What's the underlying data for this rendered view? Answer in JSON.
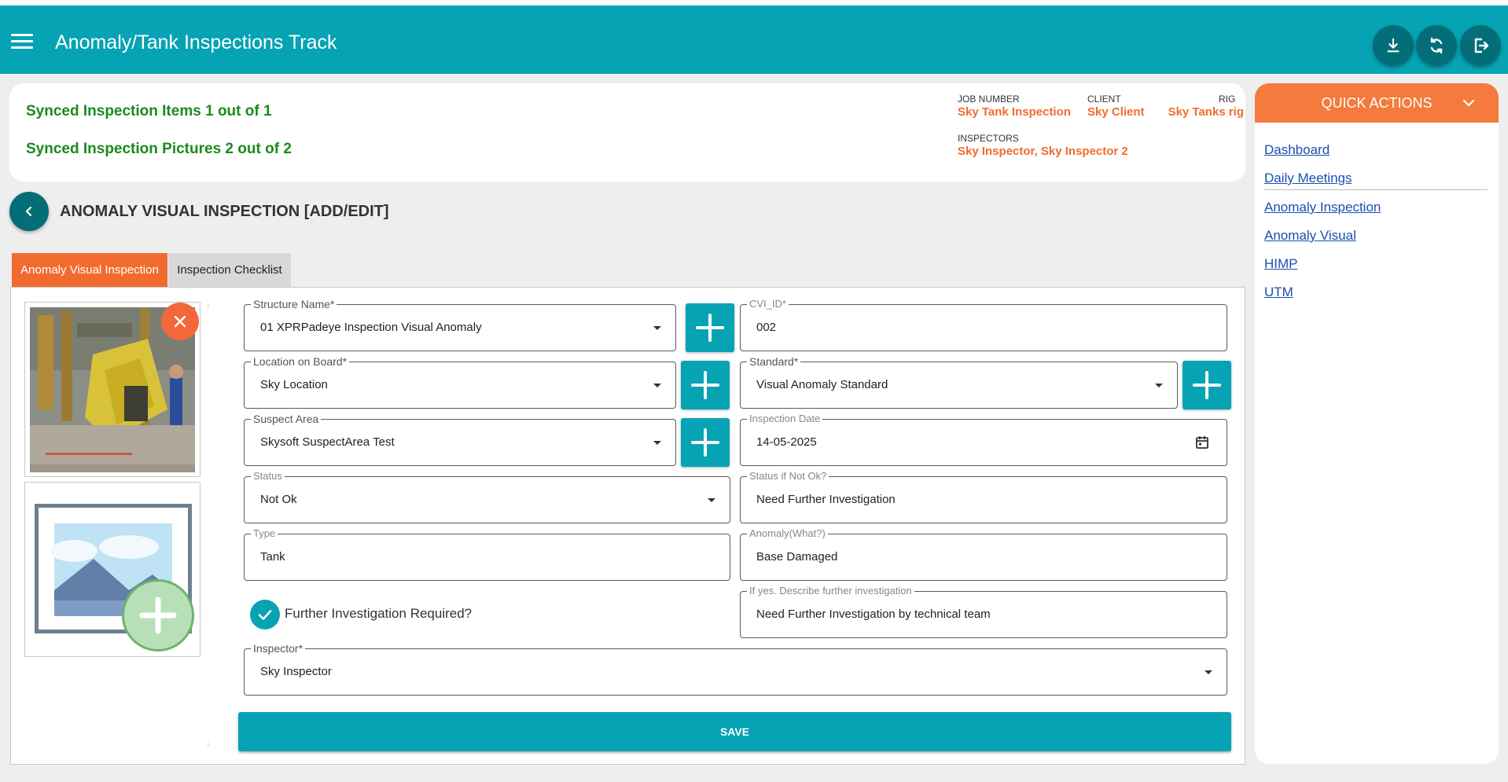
{
  "header": {
    "title": "Anomaly/Tank Inspections Track",
    "icons": [
      "download-icon",
      "sync-icon",
      "logout-icon"
    ]
  },
  "sync": {
    "items_label": "Synced Inspection Items",
    "items_count": "1",
    "items_out_of": "out of",
    "items_total": "1",
    "pictures_label": "Synced Inspection Pictures",
    "pictures_count": "2",
    "pictures_out_of": "out of",
    "pictures_total": "2"
  },
  "job": {
    "job_number_label": "JOB NUMBER",
    "job_number": "Sky Tank Inspection",
    "client_label": "CLIENT",
    "client": "Sky Client",
    "rig_label": "RIG",
    "rig": "Sky Tanks rig",
    "inspectors_label": "INSPECTORS",
    "inspectors": "Sky Inspector, Sky Inspector 2"
  },
  "quick_actions": {
    "title": "QUICK ACTIONS",
    "links": [
      "Dashboard",
      "Daily Meetings",
      "Anomaly Inspection",
      "Anomaly Visual",
      "HIMP",
      "UTM"
    ]
  },
  "page": {
    "title": "ANOMALY VISUAL INSPECTION [ADD/EDIT]"
  },
  "tabs": [
    "Anomaly Visual Inspection",
    "Inspection Checklist"
  ],
  "form": {
    "structure_name": {
      "label": "Structure Name*",
      "value": "01 XPRPadeye Inspection Visual Anomaly"
    },
    "cvi_id": {
      "label": "CVI_ID*",
      "value": "002"
    },
    "location": {
      "label": "Location on Board*",
      "value": "Sky Location"
    },
    "standard": {
      "label": "Standard*",
      "value": "Visual Anomaly Standard"
    },
    "suspect_area": {
      "label": "Suspect Area",
      "value": "Skysoft SuspectArea Test"
    },
    "inspection_date": {
      "label": "Inspection Date",
      "value": "14-05-2025"
    },
    "status": {
      "label": "Status",
      "value": "Not Ok"
    },
    "status_not_ok": {
      "label": "Status if Not Ok?",
      "value": "Need Further Investigation"
    },
    "type": {
      "label": "Type",
      "value": "Tank"
    },
    "anomaly": {
      "label": "Anomaly(What?)",
      "value": "Base Damaged"
    },
    "further_investigation": {
      "label": "Further Investigation Required?",
      "checked": true
    },
    "describe": {
      "label": "If yes. Describe further investigation",
      "value": "Need Further Investigation by technical team"
    },
    "inspector": {
      "label": "Inspector*",
      "value": "Sky Inspector"
    }
  },
  "save_label": "SAVE",
  "colors": {
    "primary": "#05a3b3",
    "accent": "#f26b2e",
    "dark_teal": "#046e78",
    "sync_green": "#1b8a1b"
  }
}
